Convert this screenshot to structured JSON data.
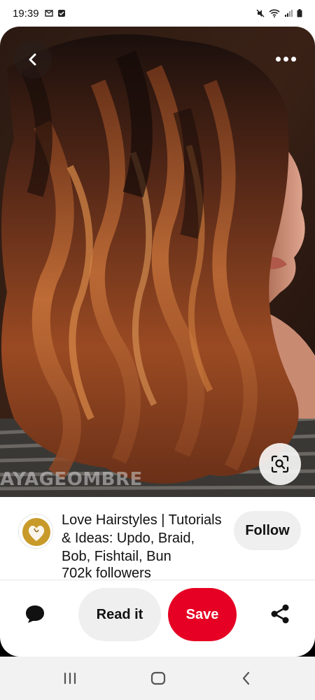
{
  "status_bar": {
    "time": "19:39",
    "left_icons": [
      "gmail-icon",
      "check-box-icon"
    ],
    "right_icons": [
      "mute-icon",
      "wifi-icon",
      "signal-icon",
      "battery-icon"
    ]
  },
  "pin": {
    "image_description_icon": "hair-photo",
    "watermark": "AYAGEOMBRE",
    "back_icon": "chevron-left-icon",
    "more_icon": "more-dots-icon",
    "lens_icon": "visual-search-icon"
  },
  "creator": {
    "name": "Love Hairstyles | Tutorials & Ideas: Updo, Braid, Bob, Fishtail, Bun",
    "followers": "702k followers",
    "follow_label": "Follow"
  },
  "actions": {
    "comment_icon": "comment-bubble-icon",
    "read_label": "Read it",
    "save_label": "Save",
    "share_icon": "share-icon"
  },
  "nav": {
    "recents_icon": "recents-icon",
    "home_icon": "home-icon",
    "back_icon": "back-icon"
  },
  "colors": {
    "save": "#e60023",
    "pill": "#efefef",
    "avatar_gold": "#c89a2a"
  }
}
